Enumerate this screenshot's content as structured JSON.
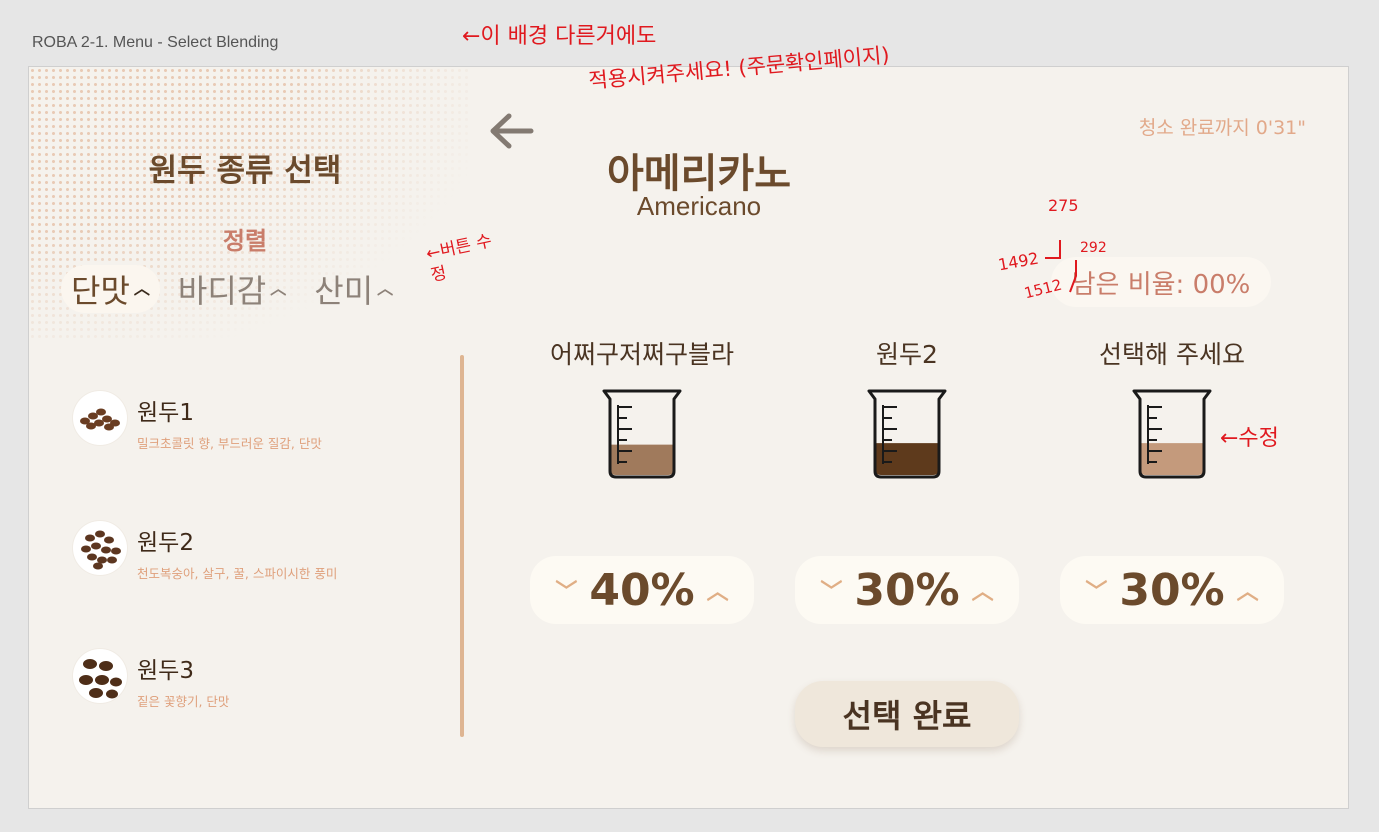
{
  "frame": {
    "title": "ROBA 2-1. Menu - Select Blending"
  },
  "colors": {
    "background": "#f5f2ed",
    "accent_brown": "#6b4a2c",
    "rose": "#c97d6a",
    "peach": "#e2a98a",
    "annotation_red": "#e0191f"
  },
  "left_panel": {
    "title": "원두 종류 선택",
    "sort_label": "정렬",
    "sort_buttons": [
      {
        "label": "단맛",
        "icon": "chevron-up-icon",
        "active": true
      },
      {
        "label": "바디감",
        "icon": "chevron-up-icon",
        "active": false
      },
      {
        "label": "산미",
        "icon": "chevron-up-icon",
        "active": false
      }
    ],
    "beans": [
      {
        "name": "원두1",
        "desc": "밀크초콜릿 향, 부드러운 질감, 단맛",
        "icon": "coffee-beans-icon"
      },
      {
        "name": "원두2",
        "desc": "천도복숭아, 살구, 꿀, 스파이시한 풍미",
        "icon": "coffee-beans-icon"
      },
      {
        "name": "원두3",
        "desc": "짙은 꽃향기, 단맛",
        "icon": "coffee-beans-icon"
      }
    ]
  },
  "header": {
    "back_icon": "back-arrow-icon",
    "cleaning_timer": "청소 완료까지 0'31\"",
    "drink_name_ko": "아메리카노",
    "drink_name_en": "Americano",
    "remaining_ratio": "남은 비율: 00%"
  },
  "blend_columns": [
    {
      "name": "어쩌구저쩌구블라",
      "percent": "40%",
      "fill_ratio": 0.4,
      "liquid_color": "#a07a5c"
    },
    {
      "name": "원두2",
      "percent": "30%",
      "fill_ratio": 0.42,
      "liquid_color": "#5e3a1c"
    },
    {
      "name": "선택해 주세요",
      "percent": "30%",
      "fill_ratio": 0.42,
      "liquid_color": "#c49a7c"
    }
  ],
  "stepper": {
    "down_icon": "chevron-down-icon",
    "up_icon": "chevron-up-icon"
  },
  "confirm_button": "선택 완료",
  "annotations": {
    "background_note_1": "←이 배경 다른거에도",
    "background_note_2": "적용시켜주세요! (주문확인페이지)",
    "button_fix": "←버튼 수정",
    "fix": "←수정",
    "m1": "275",
    "m2": "1492",
    "m3": "292",
    "m4": "1512"
  }
}
